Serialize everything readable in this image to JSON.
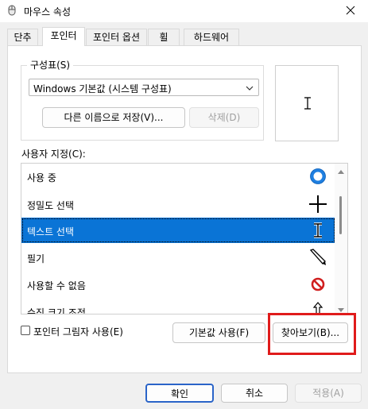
{
  "window": {
    "title": "마우스 속성",
    "app_icon": "mouse-icon",
    "close_icon": "close-icon"
  },
  "tabs": [
    {
      "label": "단추",
      "active": false
    },
    {
      "label": "포인터",
      "active": true
    },
    {
      "label": "포인터 옵션",
      "active": false
    },
    {
      "label": "휠",
      "active": false
    },
    {
      "label": "하드웨어",
      "active": false
    }
  ],
  "scheme": {
    "legend": "구성표(S)",
    "selected": "Windows 기본값 (시스템 구성표)",
    "save_button": "다른 이름으로 저장(V)...",
    "delete_button": "삭제(D)"
  },
  "customize": {
    "label": "사용자 지정(C):",
    "items": [
      {
        "label": "사용 중",
        "icon": "busy-ring-icon",
        "selected": false
      },
      {
        "label": "정밀도 선택",
        "icon": "crosshair-icon",
        "selected": false
      },
      {
        "label": "텍스트 선택",
        "icon": "text-select-icon",
        "selected": true
      },
      {
        "label": "필기",
        "icon": "pen-icon",
        "selected": false
      },
      {
        "label": "사용할 수 없음",
        "icon": "unavailable-icon",
        "selected": false
      },
      {
        "label": "수직 크기 조정",
        "icon": "vertical-resize-icon",
        "selected": false
      }
    ]
  },
  "options": {
    "shadow_checkbox": "포인터 그림자 사용(E)",
    "shadow_checked": false,
    "default_button": "기본값 사용(F)",
    "browse_button": "찾아보기(B)..."
  },
  "footer": {
    "ok": "확인",
    "cancel": "취소",
    "apply": "적용(A)"
  },
  "colors": {
    "selection": "#0a74d6",
    "highlight": "#e01b1b",
    "accent": "#2a64c8"
  }
}
